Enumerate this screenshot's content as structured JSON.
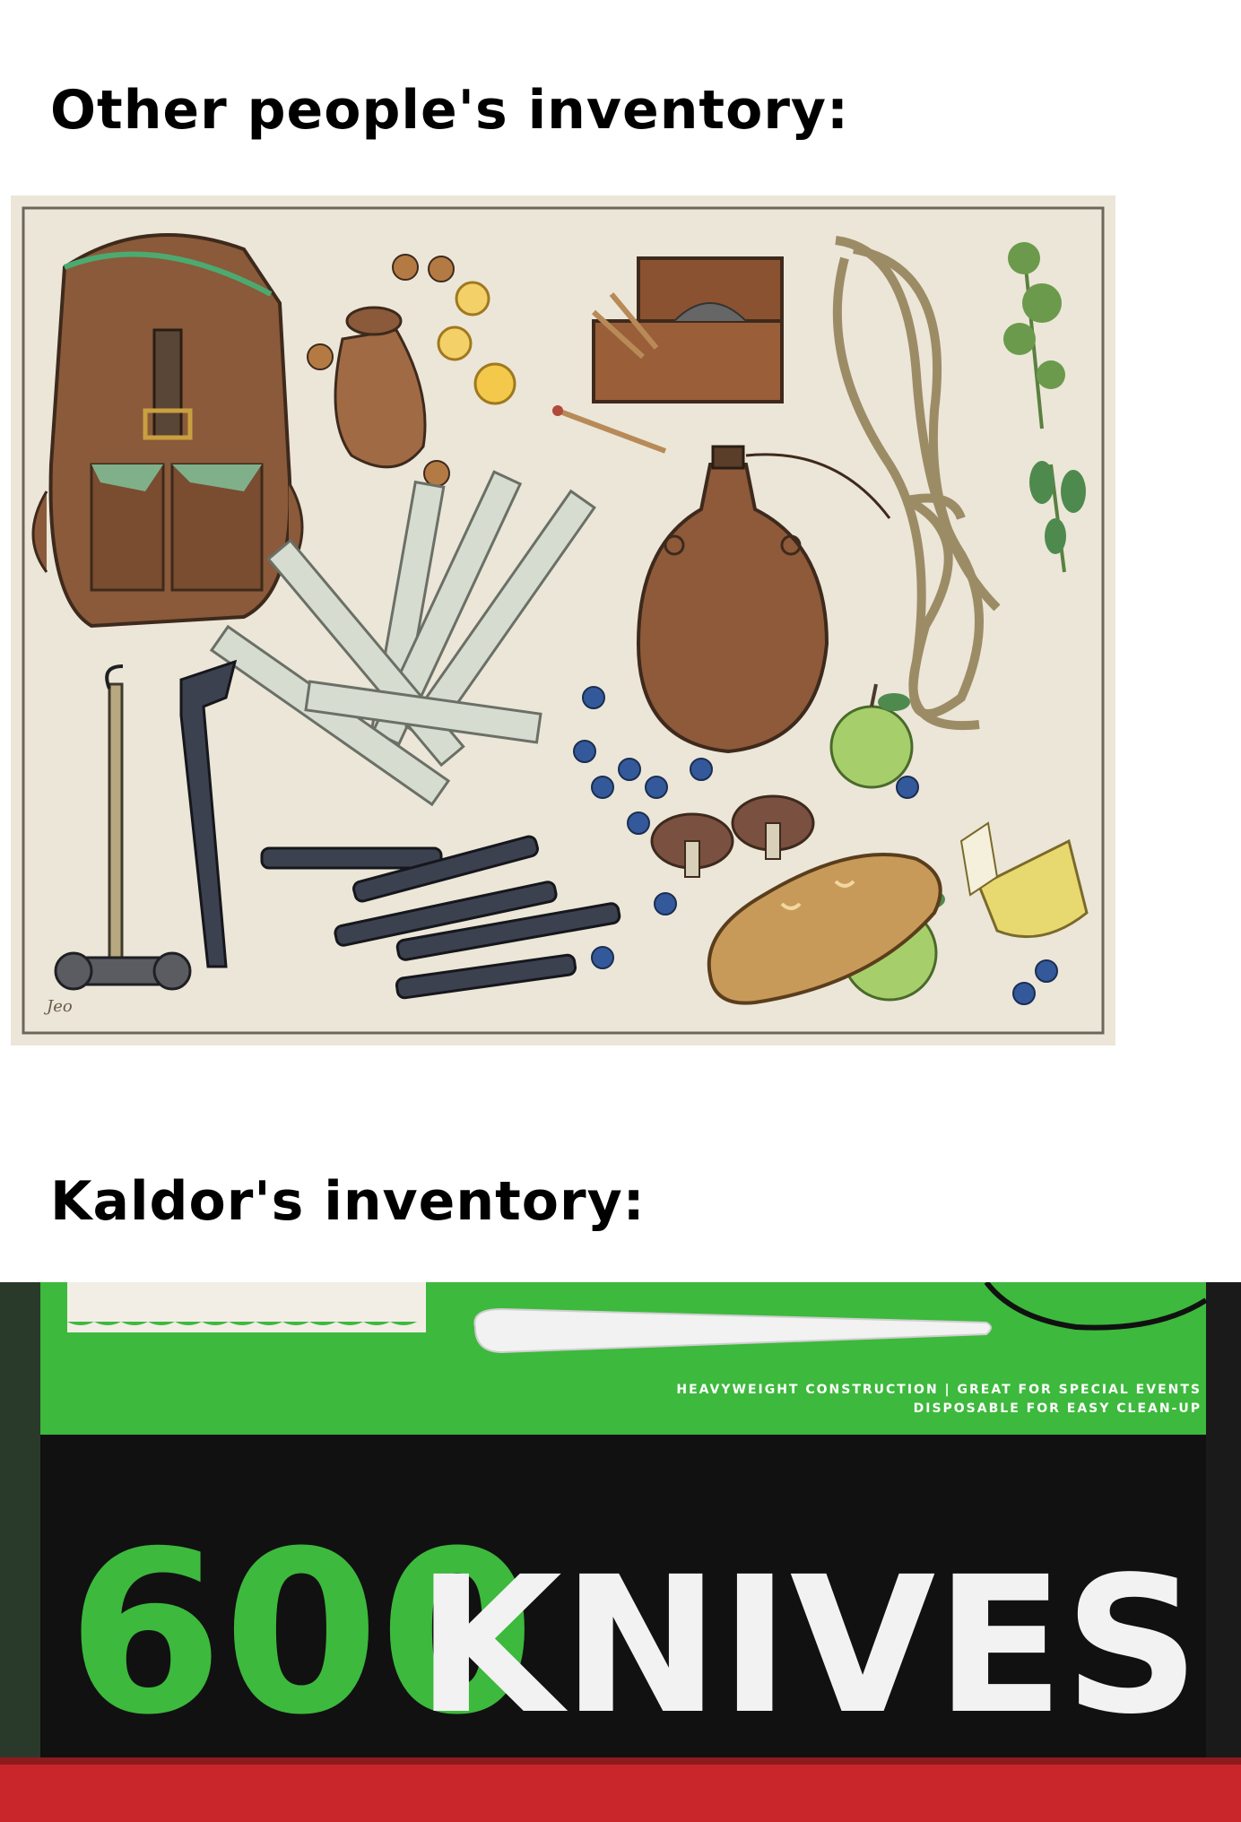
{
  "captions": {
    "top": "Other people's inventory:",
    "bottom": "Kaldor's inventory:"
  },
  "illustration": {
    "items": [
      "backpack",
      "coin-pouch",
      "coins",
      "matchbox",
      "matches",
      "rope",
      "herbs",
      "candles",
      "water-flask",
      "hammer",
      "crowbar",
      "tent-stakes",
      "blueberries",
      "mushrooms",
      "apples",
      "bread",
      "cheese"
    ],
    "signature": "Jeo"
  },
  "box": {
    "tagline_1": "HEAVYWEIGHT CONSTRUCTION  |  GREAT FOR SPECIAL EVENTS",
    "tagline_2": "DISPOSABLE FOR EASY CLEAN-UP",
    "count": "600",
    "product": "KNIVES",
    "colors": {
      "green": "#3db93d",
      "black": "#111111",
      "shelf_red": "#c8262b"
    }
  }
}
